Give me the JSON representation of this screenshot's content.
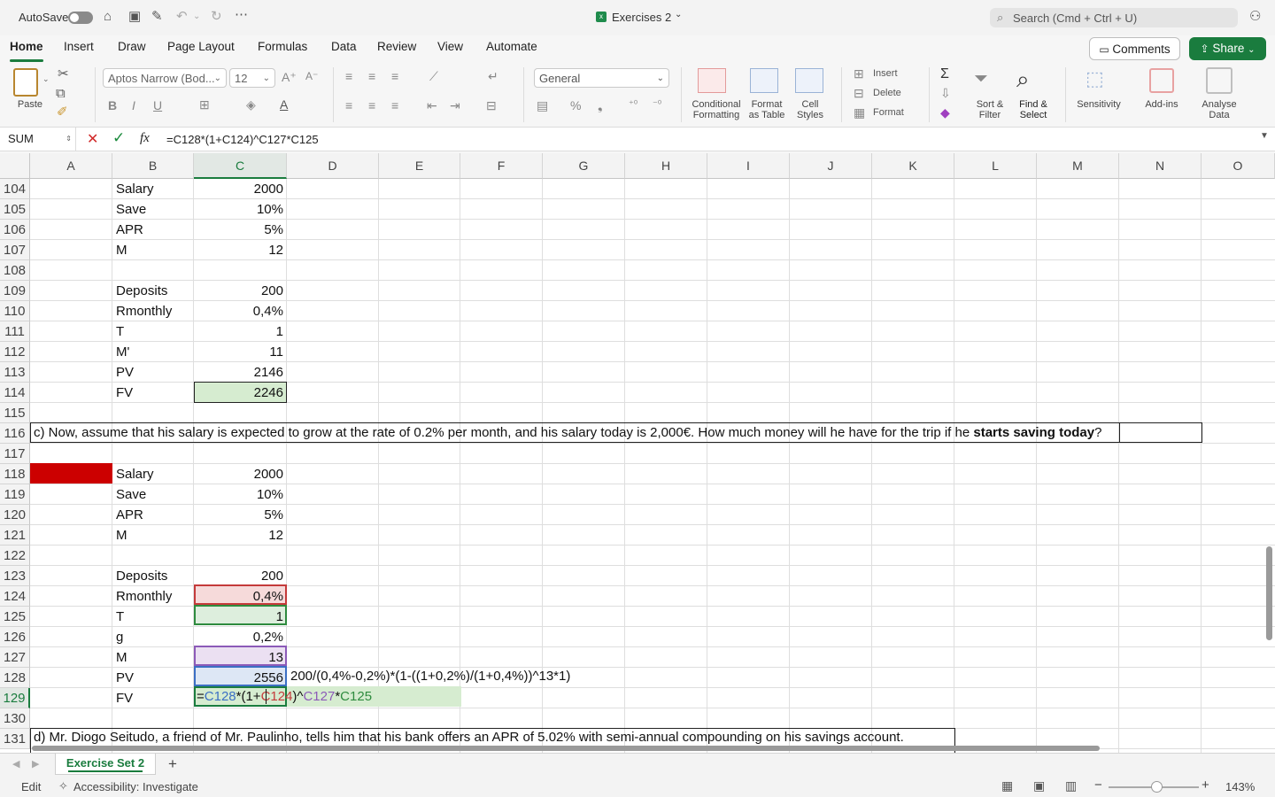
{
  "titlebar": {
    "autosave_label": "AutoSave",
    "doc_title": "Exercises 2",
    "search_placeholder": "Search (Cmd + Ctrl + U)"
  },
  "ribbon_tabs": [
    "Home",
    "Insert",
    "Draw",
    "Page Layout",
    "Formulas",
    "Data",
    "Review",
    "View",
    "Automate"
  ],
  "actions": {
    "comments": "Comments",
    "share": "Share"
  },
  "ribbon": {
    "paste": "Paste",
    "font_name": "Aptos Narrow (Bod...",
    "font_size": "12",
    "number_format": "General",
    "conditional_formatting": [
      "Conditional",
      "Formatting"
    ],
    "format_as_table": [
      "Format",
      "as Table"
    ],
    "cell_styles": [
      "Cell",
      "Styles"
    ],
    "insert": "Insert",
    "delete": "Delete",
    "format": "Format",
    "sort_filter": [
      "Sort &",
      "Filter"
    ],
    "find_select": [
      "Find &",
      "Select"
    ],
    "sensitivity": "Sensitivity",
    "addins": "Add-ins",
    "analyse": [
      "Analyse",
      "Data"
    ]
  },
  "formula_bar": {
    "name_box": "SUM",
    "fx": "fx",
    "formula": "=C128*(1+C124)^C127*C125"
  },
  "columns": [
    "A",
    "B",
    "C",
    "D",
    "E",
    "F",
    "G",
    "H",
    "I",
    "J",
    "K",
    "L",
    "M",
    "N",
    "O"
  ],
  "rows": [
    {
      "n": "104",
      "b": "Salary",
      "c": "2000"
    },
    {
      "n": "105",
      "b": "Save",
      "c": "10%"
    },
    {
      "n": "106",
      "b": "APR",
      "c": "5%"
    },
    {
      "n": "107",
      "b": "M",
      "c": "12"
    },
    {
      "n": "108",
      "b": "",
      "c": ""
    },
    {
      "n": "109",
      "b": "Deposits",
      "c": "200"
    },
    {
      "n": "110",
      "b": "Rmonthly",
      "c": "0,4%"
    },
    {
      "n": "111",
      "b": "T",
      "c": "1"
    },
    {
      "n": "112",
      "b": "M'",
      "c": "11"
    },
    {
      "n": "113",
      "b": "PV",
      "c": "2146"
    },
    {
      "n": "114",
      "b": "FV",
      "c": "2246"
    },
    {
      "n": "115",
      "b": "",
      "c": ""
    },
    {
      "n": "116",
      "b": "",
      "c": ""
    },
    {
      "n": "117",
      "b": "",
      "c": ""
    },
    {
      "n": "118",
      "b": "Salary",
      "c": "2000"
    },
    {
      "n": "119",
      "b": "Save",
      "c": "10%"
    },
    {
      "n": "120",
      "b": "APR",
      "c": "5%"
    },
    {
      "n": "121",
      "b": "M",
      "c": "12"
    },
    {
      "n": "122",
      "b": "",
      "c": ""
    },
    {
      "n": "123",
      "b": "Deposits",
      "c": "200"
    },
    {
      "n": "124",
      "b": "Rmonthly",
      "c": "0,4%"
    },
    {
      "n": "125",
      "b": "T",
      "c": "1"
    },
    {
      "n": "126",
      "b": "g",
      "c": "0,2%"
    },
    {
      "n": "127",
      "b": "M",
      "c": "13"
    },
    {
      "n": "128",
      "b": "PV",
      "c": "2556"
    },
    {
      "n": "129",
      "b": "FV",
      "c": ""
    },
    {
      "n": "130",
      "b": "",
      "c": ""
    },
    {
      "n": "131",
      "b": "",
      "c": ""
    }
  ],
  "text_116_part1": "c) Now, assume that his salary is expected to grow at the rate of 0.2% per month, and his salary today is 2,000€. How much money will he have for the trip if he ",
  "text_116_bold": "starts saving today",
  "text_116_end": "?",
  "text_128_note": "200/(0,4%-0,2%)*(1-((1+0,2%)/(1+0,4%))^13*1)",
  "text_131": "d) Mr. Diogo Seitudo, a friend of Mr. Paulinho, tells him that his bank offers an APR of 5.02% with semi-annual compounding on his savings account.",
  "edit_formula_parts": [
    "=",
    "C128",
    "*(1+",
    "C124",
    ")^",
    "C127",
    "*",
    "C125"
  ],
  "sheet_tab": "Exercise Set 2",
  "status": {
    "mode": "Edit",
    "accessibility": "Accessibility: Investigate",
    "zoom": "143%"
  }
}
